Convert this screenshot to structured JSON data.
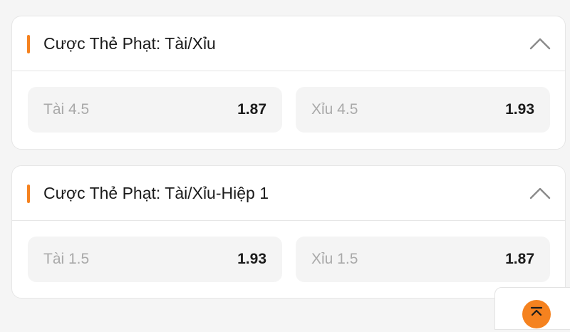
{
  "colors": {
    "accent": "#f5821f",
    "background": "#f5f5f5",
    "card": "#ffffff",
    "odd_button": "#f4f4f4",
    "label_text": "#a9a9a9",
    "value_text": "#1b1b1b"
  },
  "markets": [
    {
      "title": "Cược Thẻ Phạt: Tài/Xỉu",
      "collapse_icon": "chevron-up-icon",
      "odds": [
        {
          "label": "Tài 4.5",
          "value": "1.87"
        },
        {
          "label": "Xỉu 4.5",
          "value": "1.93"
        }
      ]
    },
    {
      "title": "Cược Thẻ Phạt: Tài/Xỉu-Hiệp 1",
      "collapse_icon": "chevron-up-icon",
      "odds": [
        {
          "label": "Tài 1.5",
          "value": "1.93"
        },
        {
          "label": "Xỉu 1.5",
          "value": "1.87"
        }
      ]
    }
  ],
  "floating": {
    "scroll_top_icon": "scroll-to-top-icon"
  }
}
